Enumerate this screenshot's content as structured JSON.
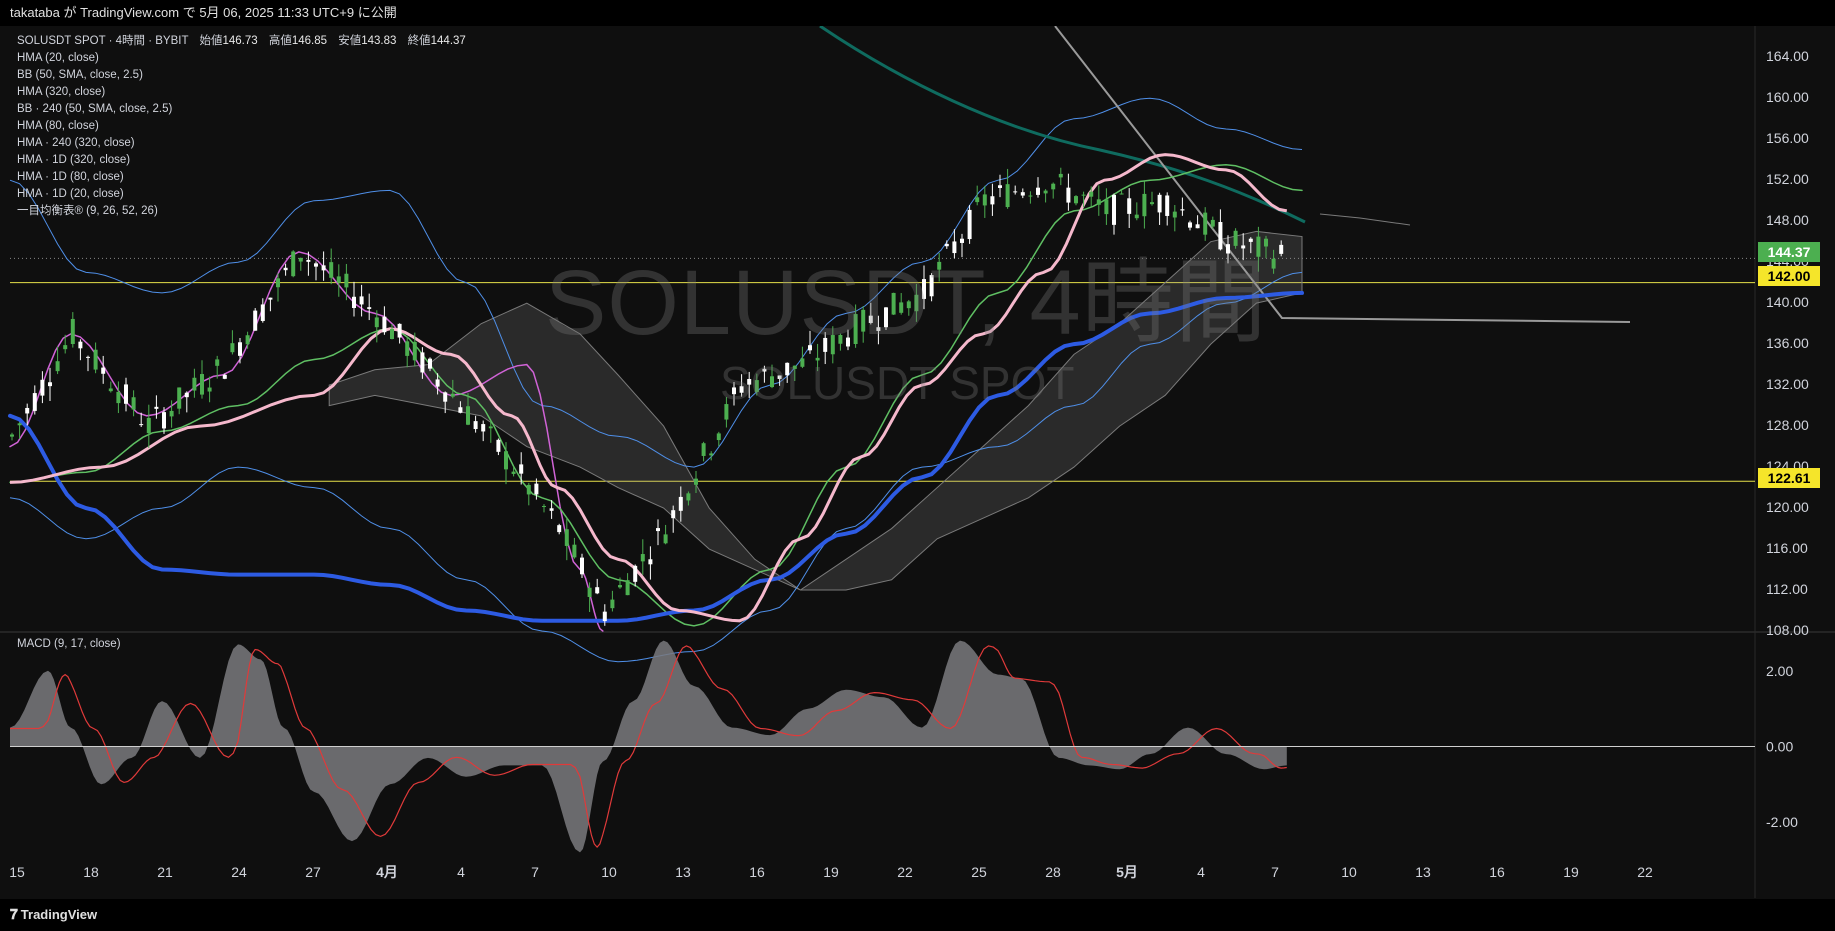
{
  "header": {
    "published_line": "takataba が TradingView.com で 5月 06, 2025 11:33 UTC+9 に公開"
  },
  "watermark": {
    "line1": "SOLUSDT, 4時間",
    "line2": "SOLUSDT SPOT"
  },
  "legend": {
    "symbol_line": "SOLUSDT SPOT · 4時間 · BYBIT",
    "open_label": "始値",
    "open": "146.73",
    "high_label": "高値",
    "high": "146.85",
    "low_label": "安値",
    "low": "143.83",
    "close_label": "終値",
    "close": "144.37",
    "indicators": [
      "HMA (20, close)",
      "BB (50, SMA, close, 2.5)",
      "HMA (320, close)",
      "BB · 240 (50, SMA, close, 2.5)",
      "HMA (80, close)",
      "HMA · 240 (320, close)",
      "HMA · 1D (320, close)",
      "HMA · 1D (80, close)",
      "HMA · 1D (20, close)",
      "一目均衡表® (9, 26, 52, 26)"
    ]
  },
  "macd_label": "MACD (9, 17, close)",
  "price_tags": {
    "last": "144.37",
    "level_high": "142.00",
    "level_low": "122.61"
  },
  "colors": {
    "background": "#0f0f0f",
    "candle_up": "#4caf50",
    "candle_down": "#ffffff",
    "hma20": "#d063d6",
    "bb": "#4f8fe8",
    "hma320": "#2d5be3",
    "hma80": "#f5b8cc",
    "hma240": "#0f6b5f",
    "green_line": "#5fbf63",
    "level_line": "#e6e04a",
    "macd_fill": "#7a7a7e",
    "macd_signal": "#e03a3a"
  },
  "footer": {
    "brand": "TradingView"
  },
  "chart_data": {
    "type": "line",
    "title": "SOLUSDT SPOT · 4時間 · BYBIT",
    "x_tick_labels": [
      "15",
      "18",
      "21",
      "24",
      "27",
      "4月",
      "4",
      "7",
      "10",
      "13",
      "16",
      "19",
      "22",
      "25",
      "28",
      "5月",
      "4",
      "7",
      "10",
      "13",
      "16",
      "19",
      "22"
    ],
    "y_tick_labels": [
      "164.00",
      "160.00",
      "156.00",
      "152.00",
      "148.00",
      "144.00",
      "140.00",
      "136.00",
      "132.00",
      "128.00",
      "124.00",
      "120.00",
      "116.00",
      "112.00",
      "108.00"
    ],
    "ylim": [
      108,
      165
    ],
    "horizontal_levels": [
      142.0,
      122.61
    ],
    "last_price": 144.37,
    "series": [
      {
        "name": "HMA (20, close)",
        "x": [
          0,
          8,
          18,
          28,
          38,
          48,
          58,
          68,
          75,
          78
        ],
        "y": [
          126,
          137,
          129,
          133,
          145,
          139,
          131,
          134,
          114,
          108
        ]
      },
      {
        "name": "HMA (80, close)",
        "x": [
          0,
          10,
          20,
          30,
          40,
          50,
          60,
          70,
          80,
          90,
          100,
          110,
          120,
          130,
          140,
          150,
          160,
          170
        ],
        "y": [
          122.5,
          123.5,
          127.5,
          130,
          134.5,
          137.5,
          131,
          121,
          113,
          108.5,
          114,
          124,
          133,
          141,
          149,
          152,
          153.5,
          151
        ]
      },
      {
        "name": "HMA (320, close)",
        "x": [
          0,
          10,
          20,
          30,
          40,
          50,
          60,
          70,
          80,
          90,
          100,
          110,
          120,
          130,
          140,
          150,
          160,
          170
        ],
        "y": [
          129,
          120,
          114,
          113.5,
          113.5,
          112.5,
          110,
          109,
          109,
          110,
          113,
          117.5,
          123,
          131,
          136,
          139,
          140.5,
          141
        ]
      }
    ],
    "macd": {
      "label": "MACD (9, 17, close)",
      "y_tick_labels": [
        "2.00",
        "0.00",
        "-2.00"
      ],
      "ylim": [
        -3,
        3
      ],
      "histogram_x": [
        0,
        5,
        8,
        12,
        16,
        20,
        25,
        30,
        33,
        36,
        40,
        45,
        50,
        55,
        60,
        65,
        70,
        75,
        78,
        82,
        86,
        90,
        95,
        100,
        105,
        110,
        115,
        120,
        125,
        130,
        133,
        138,
        142,
        146,
        150,
        155,
        160,
        165,
        168
      ],
      "histogram_y": [
        0.5,
        2.0,
        0.5,
        -1.0,
        -0.3,
        1.2,
        -0.3,
        2.7,
        2.3,
        0.5,
        -1.2,
        -2.5,
        -1.0,
        -0.3,
        -0.8,
        -0.5,
        -0.5,
        -2.8,
        -0.4,
        1.2,
        2.8,
        1.6,
        0.5,
        0.3,
        1.0,
        1.5,
        1.3,
        0.5,
        2.8,
        1.9,
        1.8,
        -0.3,
        -0.5,
        -0.6,
        -0.2,
        0.5,
        -0.2,
        -0.6,
        -0.5
      ]
    }
  }
}
